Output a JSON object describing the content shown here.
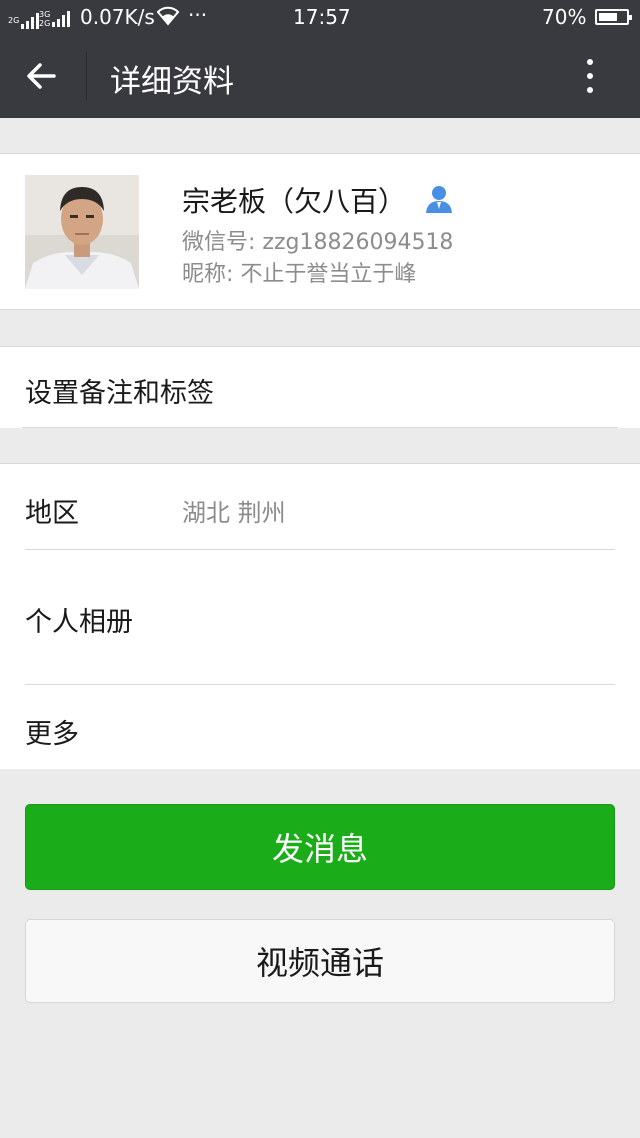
{
  "status_bar": {
    "network_left": "2G",
    "network_right_top": "3G",
    "network_right_bottom": "2G",
    "speed": "0.07K/s",
    "more": "···",
    "time": "17:57",
    "battery": "70%",
    "battery_level": 0.7
  },
  "header": {
    "title": "详细资料",
    "back_icon": "arrow-left-icon",
    "more_icon": "more-vertical-icon"
  },
  "profile": {
    "name": "宗老板（欠八百）",
    "wechat_id": "微信号: zzg18826094518",
    "nickname": "昵称: 不止于誉当立于峰",
    "contact_icon": "person-icon",
    "accent_color": "#4a90e2"
  },
  "remark": {
    "label": "设置备注和标签"
  },
  "info_rows": [
    {
      "label": "地区",
      "value": "湖北  荆州"
    },
    {
      "label": "个人相册",
      "value": ""
    },
    {
      "label": "更多",
      "value": ""
    }
  ],
  "buttons": {
    "send_message": "发消息",
    "video_call": "视频通话"
  },
  "colors": {
    "header_bg": "#393a3f",
    "page_bg": "#ebebeb",
    "primary_green": "#1aad19"
  }
}
